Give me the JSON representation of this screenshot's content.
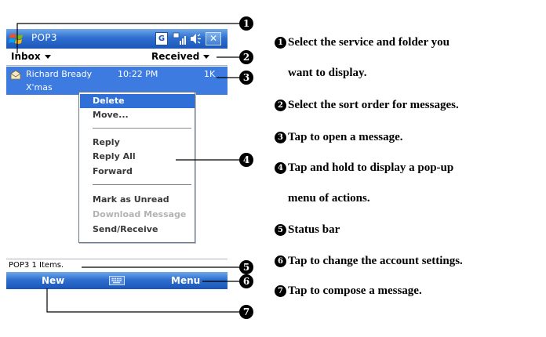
{
  "window": {
    "title": "POP3",
    "icons": [
      "windows-logo-icon",
      "connectivity-icon",
      "signal-icon",
      "volume-icon",
      "close-icon"
    ]
  },
  "header": {
    "folder": "Inbox",
    "sort": "Received"
  },
  "message": {
    "from": "Richard Bready",
    "time": "10:22 PM",
    "size": "1K",
    "subject": "X'mas"
  },
  "context_menu": {
    "items": [
      {
        "label": "Delete"
      },
      {
        "label": "Move..."
      },
      {
        "label": "Reply"
      },
      {
        "label": "Reply All"
      },
      {
        "label": "Forward"
      },
      {
        "label": "Mark as Unread"
      },
      {
        "label": "Download Message"
      },
      {
        "label": "Send/Receive"
      }
    ]
  },
  "status": {
    "text": "POP3 1 Items."
  },
  "menubar": {
    "left": "New",
    "right": "Menu"
  },
  "callouts": [
    "1",
    "2",
    "3",
    "4",
    "5",
    "6",
    "7"
  ],
  "legend": [
    {
      "num": "1",
      "text": "Select the service and folder you"
    },
    {
      "num": "",
      "text": "want to display."
    },
    {
      "num": "2",
      "text": "Select the sort order for messages."
    },
    {
      "num": "3",
      "text": "Tap to open a message."
    },
    {
      "num": "4",
      "text": "Tap and hold to display a pop-up"
    },
    {
      "num": "",
      "text": "menu of actions."
    },
    {
      "num": "5",
      "text": "Status bar"
    },
    {
      "num": "6",
      "text": "Tap to change the account settings."
    },
    {
      "num": "7",
      "text": "Tap to compose a message."
    }
  ],
  "colors": {
    "titlebar": "#2f6fcf",
    "selection": "#3d7be0",
    "menu_selection": "#2f6fd6",
    "callout": "#000000"
  }
}
